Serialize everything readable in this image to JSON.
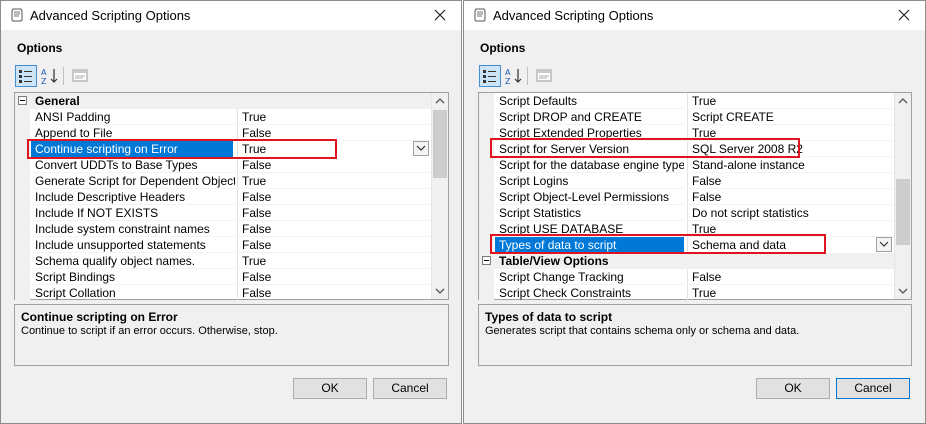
{
  "left": {
    "title": "Advanced Scripting Options",
    "options_label": "Options",
    "rows": [
      {
        "type": "cat",
        "name": "General"
      },
      {
        "name": "ANSI Padding",
        "value": "True"
      },
      {
        "name": "Append to File",
        "value": "False"
      },
      {
        "name": "Continue scripting on Error",
        "value": "True",
        "selected": true
      },
      {
        "name": "Convert UDDTs to Base Types",
        "value": "False"
      },
      {
        "name": "Generate Script for Dependent Objects",
        "value": "True"
      },
      {
        "name": "Include Descriptive Headers",
        "value": "False"
      },
      {
        "name": "Include If NOT EXISTS",
        "value": "False"
      },
      {
        "name": "Include system constraint names",
        "value": "False"
      },
      {
        "name": "Include unsupported statements",
        "value": "False"
      },
      {
        "name": "Schema qualify object names.",
        "value": "True"
      },
      {
        "name": "Script Bindings",
        "value": "False"
      },
      {
        "name": "Script Collation",
        "value": "False"
      }
    ],
    "description": {
      "title": "Continue scripting on Error",
      "text": "Continue to script if an error occurs. Otherwise, stop."
    },
    "ok_label": "OK",
    "cancel_label": "Cancel"
  },
  "right": {
    "title": "Advanced Scripting Options",
    "options_label": "Options",
    "rows": [
      {
        "name": "Script Defaults",
        "value": "True"
      },
      {
        "name": "Script DROP and CREATE",
        "value": "Script CREATE"
      },
      {
        "name": "Script Extended Properties",
        "value": "True"
      },
      {
        "name": "Script for Server Version",
        "value": "SQL Server 2008 R2",
        "highlighted": true
      },
      {
        "name": "Script for the database engine type",
        "value": "Stand-alone instance"
      },
      {
        "name": "Script Logins",
        "value": "False"
      },
      {
        "name": "Script Object-Level Permissions",
        "value": "False"
      },
      {
        "name": "Script Statistics",
        "value": "Do not script statistics"
      },
      {
        "name": "Script USE DATABASE",
        "value": "True"
      },
      {
        "name": "Types of data to script",
        "value": "Schema and data",
        "selected": true,
        "highlighted": true
      },
      {
        "type": "cat",
        "name": "Table/View Options"
      },
      {
        "name": "Script Change Tracking",
        "value": "False"
      },
      {
        "name": "Script Check Constraints",
        "value": "True"
      }
    ],
    "description": {
      "title": "Types of data to script",
      "text": "Generates script that contains schema only or schema and data."
    },
    "ok_label": "OK",
    "cancel_label": "Cancel"
  },
  "colors": {
    "selection": "#0078d7",
    "highlight_box": "#e0141e",
    "dialog_bg": "#f0f0f0"
  },
  "icons": {
    "title": "scroll-icon",
    "categorized": "categorized-view-icon",
    "alphabetical": "alphabetical-sort-icon",
    "property_pages": "property-pages-icon",
    "close": "close-icon",
    "dropdown": "chevron-down-icon"
  }
}
